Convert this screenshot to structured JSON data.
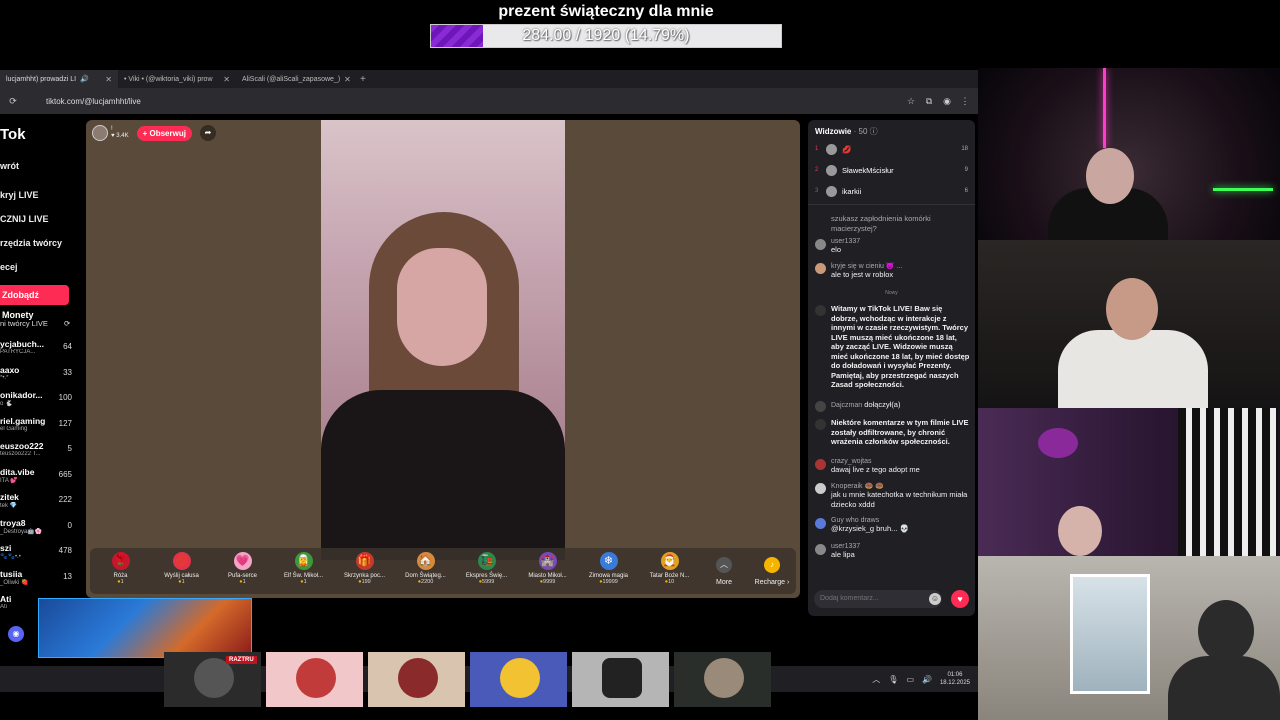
{
  "goal": {
    "title": "prezent świąteczny dla mnie",
    "progress_text": "284.00 / 1920 (14.79%)",
    "progress_pct": 14.79
  },
  "browser": {
    "tabs": [
      {
        "label": "lucjamhht) prowadzi LI",
        "active": true
      },
      {
        "label": "• Viki • (@wiktoria_viki) prow"
      },
      {
        "label": "AliScali (@aliScali_zapasowe_)"
      }
    ],
    "new_tab": "+",
    "url": "tiktok.com/@lucjamhht/live"
  },
  "sidebar": {
    "logo": "Tok",
    "nav": [
      "wrót",
      "kryj LIVE",
      "CZNIJ LIVE",
      "rzędzia twórcy",
      "ecej"
    ],
    "coins_button": "Zdobądź Monety",
    "creators_heading": "ni twórcy LIVE",
    "creators": [
      {
        "name": "ycjabuch...",
        "sub": "PATRYCJA...",
        "count": "64"
      },
      {
        "name": "aaxo",
        "sub": "*•.*",
        "count": "33"
      },
      {
        "name": "onikador...",
        "sub": "o 🐇",
        "count": "100"
      },
      {
        "name": "riel.gaming",
        "sub": "el Gaming",
        "count": "127"
      },
      {
        "name": "euszoo222",
        "sub": "teuszoo222 T...",
        "count": "5"
      },
      {
        "name": "dita.vibe",
        "sub": "ITA 💕",
        "count": "665"
      },
      {
        "name": "zitek",
        "sub": "tek 💎",
        "count": "222"
      },
      {
        "name": "troya8",
        "sub": "_Destroya🤖🌸",
        "count": "0"
      },
      {
        "name": "szi",
        "sub": "🐾🐾•.•",
        "count": "478"
      },
      {
        "name": "tusiia",
        "sub": "_Oliwki 🍓",
        "count": "13"
      },
      {
        "name": "Ati",
        "sub": "Ati",
        "count": ""
      }
    ]
  },
  "player": {
    "host_name": "!",
    "host_likes": "3.4K",
    "follow_label": "+ Obserwuj",
    "gifts": [
      {
        "name": "Róża",
        "price": "1",
        "icon": "🌹"
      },
      {
        "name": "Wyślij całusa",
        "price": "1",
        "icon": "💋"
      },
      {
        "name": "Pufa-serce",
        "price": "1",
        "icon": "💗"
      },
      {
        "name": "Elf Św. Mikoł...",
        "price": "1",
        "icon": "🧝"
      },
      {
        "name": "Skrzynka poc...",
        "price": "199",
        "icon": "🎁"
      },
      {
        "name": "Dom Świąteg...",
        "price": "2200",
        "icon": "🏠"
      },
      {
        "name": "Ekspres Świę...",
        "price": "5999",
        "icon": "🚂"
      },
      {
        "name": "Miasto Mikoł...",
        "price": "9999",
        "icon": "🏰"
      },
      {
        "name": "Zimowa magia",
        "price": "19999",
        "icon": "❄"
      },
      {
        "name": "Tatar Boże N...",
        "price": "10",
        "icon": "🎅"
      }
    ],
    "more_label": "More",
    "recharge_label": "Recharge ›"
  },
  "chat": {
    "title": "Widzowie",
    "viewer_count": "· 50",
    "top_viewers": [
      {
        "rank": "1",
        "name": "💋",
        "score": "18"
      },
      {
        "rank": "2",
        "name": "SławekMścisłur",
        "score": "9"
      },
      {
        "rank": "3",
        "name": "ikarkii",
        "score": "6"
      }
    ],
    "partial_msg": "szukasz zapłodnienia komórki macierzystej?",
    "messages": [
      {
        "user": "user1337",
        "text": "elo"
      },
      {
        "user": "kryje się w cieniu 😈 ...",
        "text": "ale to jest w roblox"
      }
    ],
    "new_label": "Nowy",
    "system_welcome": "Witamy w TikTok LIVE! Baw się dobrze, wchodząc w interakcje z innymi w czasie rzeczywistym. Twórcy LIVE muszą mieć ukończone 18 lat, aby zacząć LIVE. Widzowie muszą mieć ukończone 18 lat, by mieć dostęp do doładowań i wysyłać Prezenty. Pamiętaj, aby przestrzegać naszych Zasad społeczności.",
    "join": {
      "user": "Dajczman",
      "text": "dołączył(a)"
    },
    "system_filter": "Niektóre komentarze w tym filmie LIVE zostały odfiltrowane, by chronić wrażenia członków społeczności.",
    "messages2": [
      {
        "user": "crazy_wojtas",
        "text": "dawaj live z tego adopt me"
      },
      {
        "user": "Knoperaik 🍩 🍩",
        "text": "jak u mnie katechotka w technikum miała dziecko xddd"
      },
      {
        "user": "Guy who draws",
        "text": "@krzysiek_g bruh... 💀"
      },
      {
        "user": "user1337",
        "text": "ale lipa"
      }
    ],
    "input_placeholder": "Dodaj komentarz..."
  },
  "taskbar": {
    "time": "01:06",
    "date": "18.12.2025"
  },
  "overlay": {
    "raz_label": "RAZTRU"
  },
  "colors": {
    "accent": "#fe2c55",
    "goal_fill": "#8a2ad6"
  }
}
